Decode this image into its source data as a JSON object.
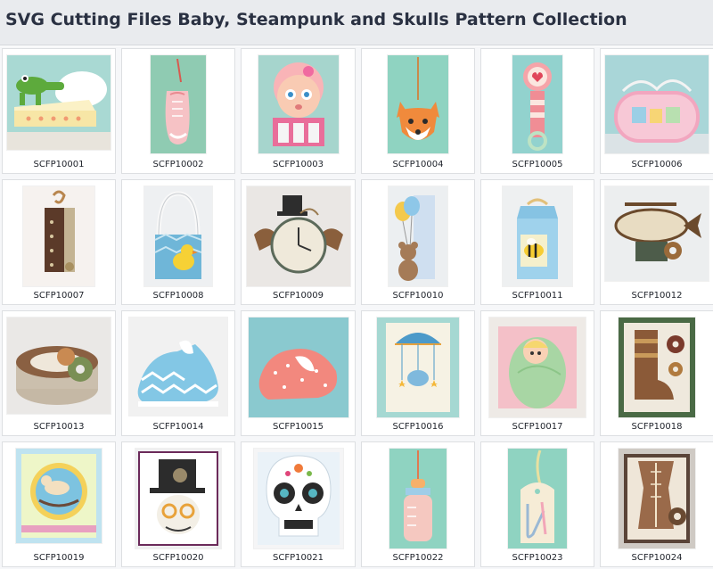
{
  "page": {
    "title": "SVG Cutting Files Baby, Steampunk and Skulls Pattern Collection"
  },
  "items": [
    {
      "code": "SCFP10001",
      "icon": "alligator-cloud-box-icon"
    },
    {
      "code": "SCFP10002",
      "icon": "sneaker-tag-icon"
    },
    {
      "code": "SCFP10003",
      "icon": "baby-girl-box-icon"
    },
    {
      "code": "SCFP10004",
      "icon": "fox-tag-icon"
    },
    {
      "code": "SCFP10005",
      "icon": "rattle-icon"
    },
    {
      "code": "SCFP10006",
      "icon": "baby-card-box-icon"
    },
    {
      "code": "SCFP10007",
      "icon": "steampunk-bag-icon"
    },
    {
      "code": "SCFP10008",
      "icon": "duck-basket-icon"
    },
    {
      "code": "SCFP10009",
      "icon": "winged-clock-icon"
    },
    {
      "code": "SCFP10010",
      "icon": "teddy-balloon-box-icon"
    },
    {
      "code": "SCFP10011",
      "icon": "bee-milk-carton-icon"
    },
    {
      "code": "SCFP10012",
      "icon": "airship-icon"
    },
    {
      "code": "SCFP10013",
      "icon": "gear-box-icon"
    },
    {
      "code": "SCFP10014",
      "icon": "blue-baby-shoe-icon"
    },
    {
      "code": "SCFP10015",
      "icon": "pink-baby-shoe-icon"
    },
    {
      "code": "SCFP10016",
      "icon": "elephant-mobile-card-icon"
    },
    {
      "code": "SCFP10017",
      "icon": "swaddled-baby-card-icon"
    },
    {
      "code": "SCFP10018",
      "icon": "steampunk-boot-card-icon"
    },
    {
      "code": "SCFP10019",
      "icon": "rocking-horse-card-icon"
    },
    {
      "code": "SCFP10020",
      "icon": "top-hat-skull-card-icon"
    },
    {
      "code": "SCFP10021",
      "icon": "sugar-skull-card-icon"
    },
    {
      "code": "SCFP10022",
      "icon": "baby-bottle-tag-icon"
    },
    {
      "code": "SCFP10023",
      "icon": "safety-pin-tag-icon"
    },
    {
      "code": "SCFP10024",
      "icon": "corset-card-icon"
    }
  ]
}
